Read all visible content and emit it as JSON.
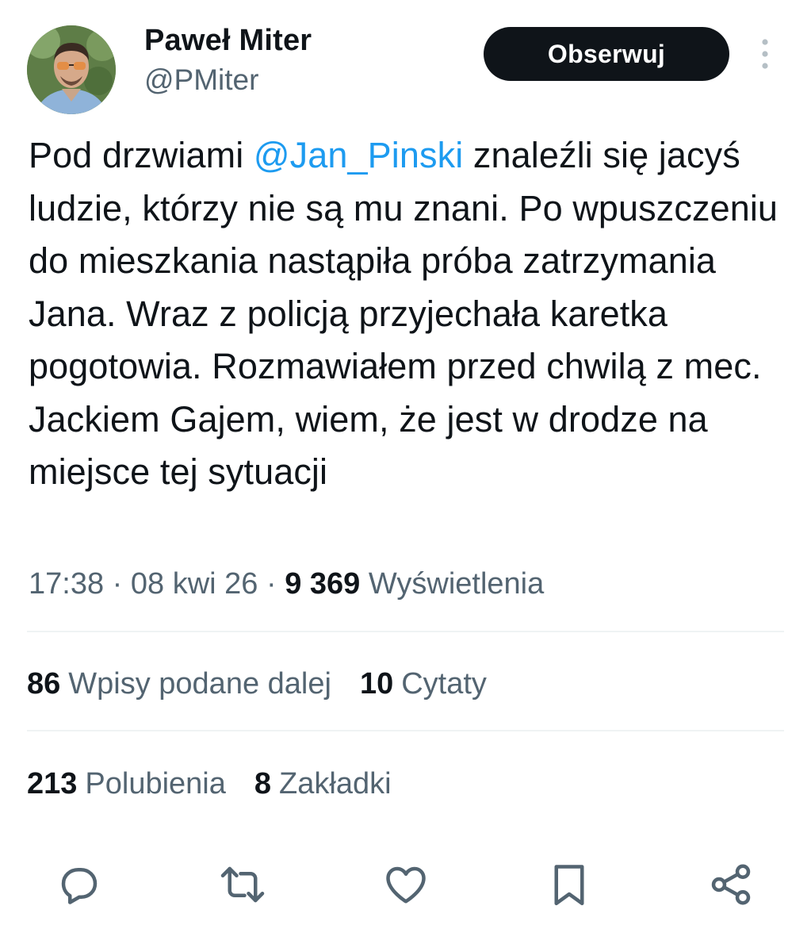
{
  "author": {
    "display_name": "Paweł Miter",
    "handle": "@PMiter",
    "follow_label": "Obserwuj"
  },
  "tweet": {
    "text_before": "Pod drzwiami ",
    "mention": "@Jan_Pinski",
    "text_after": "  znaleźli się jacyś ludzie, którzy nie są mu znani. Po wpuszczeniu do mieszkania nastąpiła próba zatrzymania Jana. Wraz z policją przyjechała karetka pogotowia. Rozmawiałem przed chwilą z mec. Jackiem Gajem, wiem, że jest w drodze na miejsce tej sytuacji"
  },
  "meta": {
    "time": "17:38",
    "separator": " · ",
    "date": "08 kwi 26",
    "views_count": "9 369",
    "views_label": "Wyświetlenia"
  },
  "stats": {
    "retweets_count": "86",
    "retweets_label": "Wpisy podane dalej",
    "quotes_count": "10",
    "quotes_label": "Cytaty",
    "likes_count": "213",
    "likes_label": "Polubienia",
    "bookmarks_count": "8",
    "bookmarks_label": "Zakładki"
  },
  "icons": {
    "reply": "reply-icon",
    "retweet": "retweet-icon",
    "like": "heart-icon",
    "bookmark": "bookmark-icon",
    "share": "share-icon",
    "more": "more-vertical-icon"
  },
  "colors": {
    "text": "#0f1419",
    "secondary": "#536471",
    "link": "#1d9bf0",
    "button_bg": "#0f1419",
    "divider": "#eff3f4"
  }
}
